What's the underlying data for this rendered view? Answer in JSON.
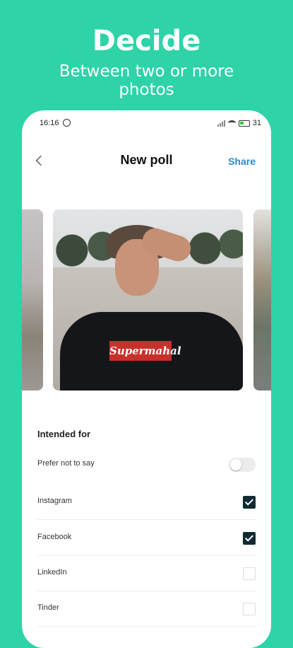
{
  "hero": {
    "title": "Decide",
    "subtitle_line1": "Between two or more",
    "subtitle_line2": "photos"
  },
  "statusbar": {
    "time": "16:16",
    "battery": "31"
  },
  "navbar": {
    "title": "New poll",
    "share_label": "Share"
  },
  "photo": {
    "shirt_text": "Supermahal"
  },
  "intended_for": {
    "title": "Intended for",
    "prefer_not_to_say": {
      "label": "Prefer not to say",
      "on": false
    },
    "options": [
      {
        "label": "Instagram",
        "checked": true
      },
      {
        "label": "Facebook",
        "checked": true
      },
      {
        "label": "LinkedIn",
        "checked": false
      },
      {
        "label": "Tinder",
        "checked": false
      }
    ]
  },
  "colors": {
    "background": "#2ed3a8",
    "accent": "#2a8ad8",
    "checkbox_checked": "#0f2a30"
  }
}
